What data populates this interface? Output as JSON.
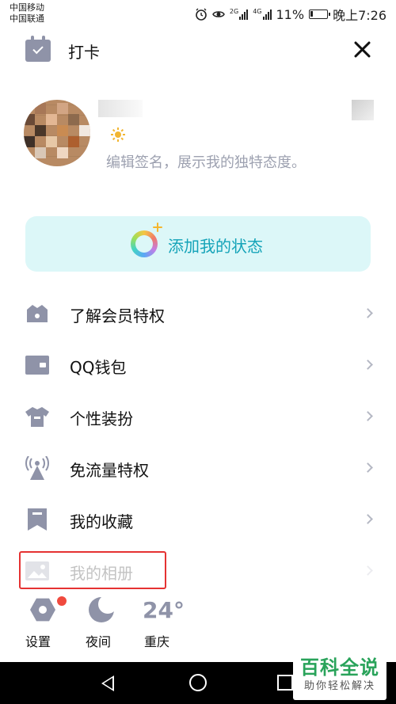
{
  "status_bar": {
    "carrier_1": "中国移动",
    "carrier_2": "中国联通",
    "signal_1_label": "2G",
    "signal_2_label": "4G",
    "battery": "11%",
    "time": "晚上7:26",
    "icons": [
      "alarm-icon",
      "eye-icon",
      "signal-icon",
      "battery-icon"
    ]
  },
  "header": {
    "checkin_label": "打卡",
    "icons": [
      "calendar-check-icon",
      "close-icon"
    ]
  },
  "profile": {
    "signature_placeholder": "编辑签名，展示我的独特态度。",
    "icons": [
      "avatar",
      "sun-icon"
    ]
  },
  "status_card": {
    "label": "添加我的状态",
    "bg_color": "#dcf7f8",
    "accent": "#14a3b8"
  },
  "menu": {
    "items": [
      {
        "label": "了解会员特权",
        "icon": "crown-icon"
      },
      {
        "label": "QQ钱包",
        "icon": "wallet-icon"
      },
      {
        "label": "个性装扮",
        "icon": "shirt-icon"
      },
      {
        "label": "免流量特权",
        "icon": "antenna-icon"
      },
      {
        "label": "我的收藏",
        "icon": "bookmark-icon"
      },
      {
        "label": "我的相册",
        "icon": "photo-icon"
      }
    ],
    "icon_color": "#8f93a8",
    "highlight_color": "#e53232"
  },
  "shortcuts": {
    "settings_label": "设置",
    "night_label": "夜间",
    "temperature": "24°",
    "city": "重庆",
    "badge_color": "#f04a3e"
  },
  "watermark": {
    "main": "百科全说",
    "sub": "助你轻松解决",
    "color": "#29a35a"
  }
}
